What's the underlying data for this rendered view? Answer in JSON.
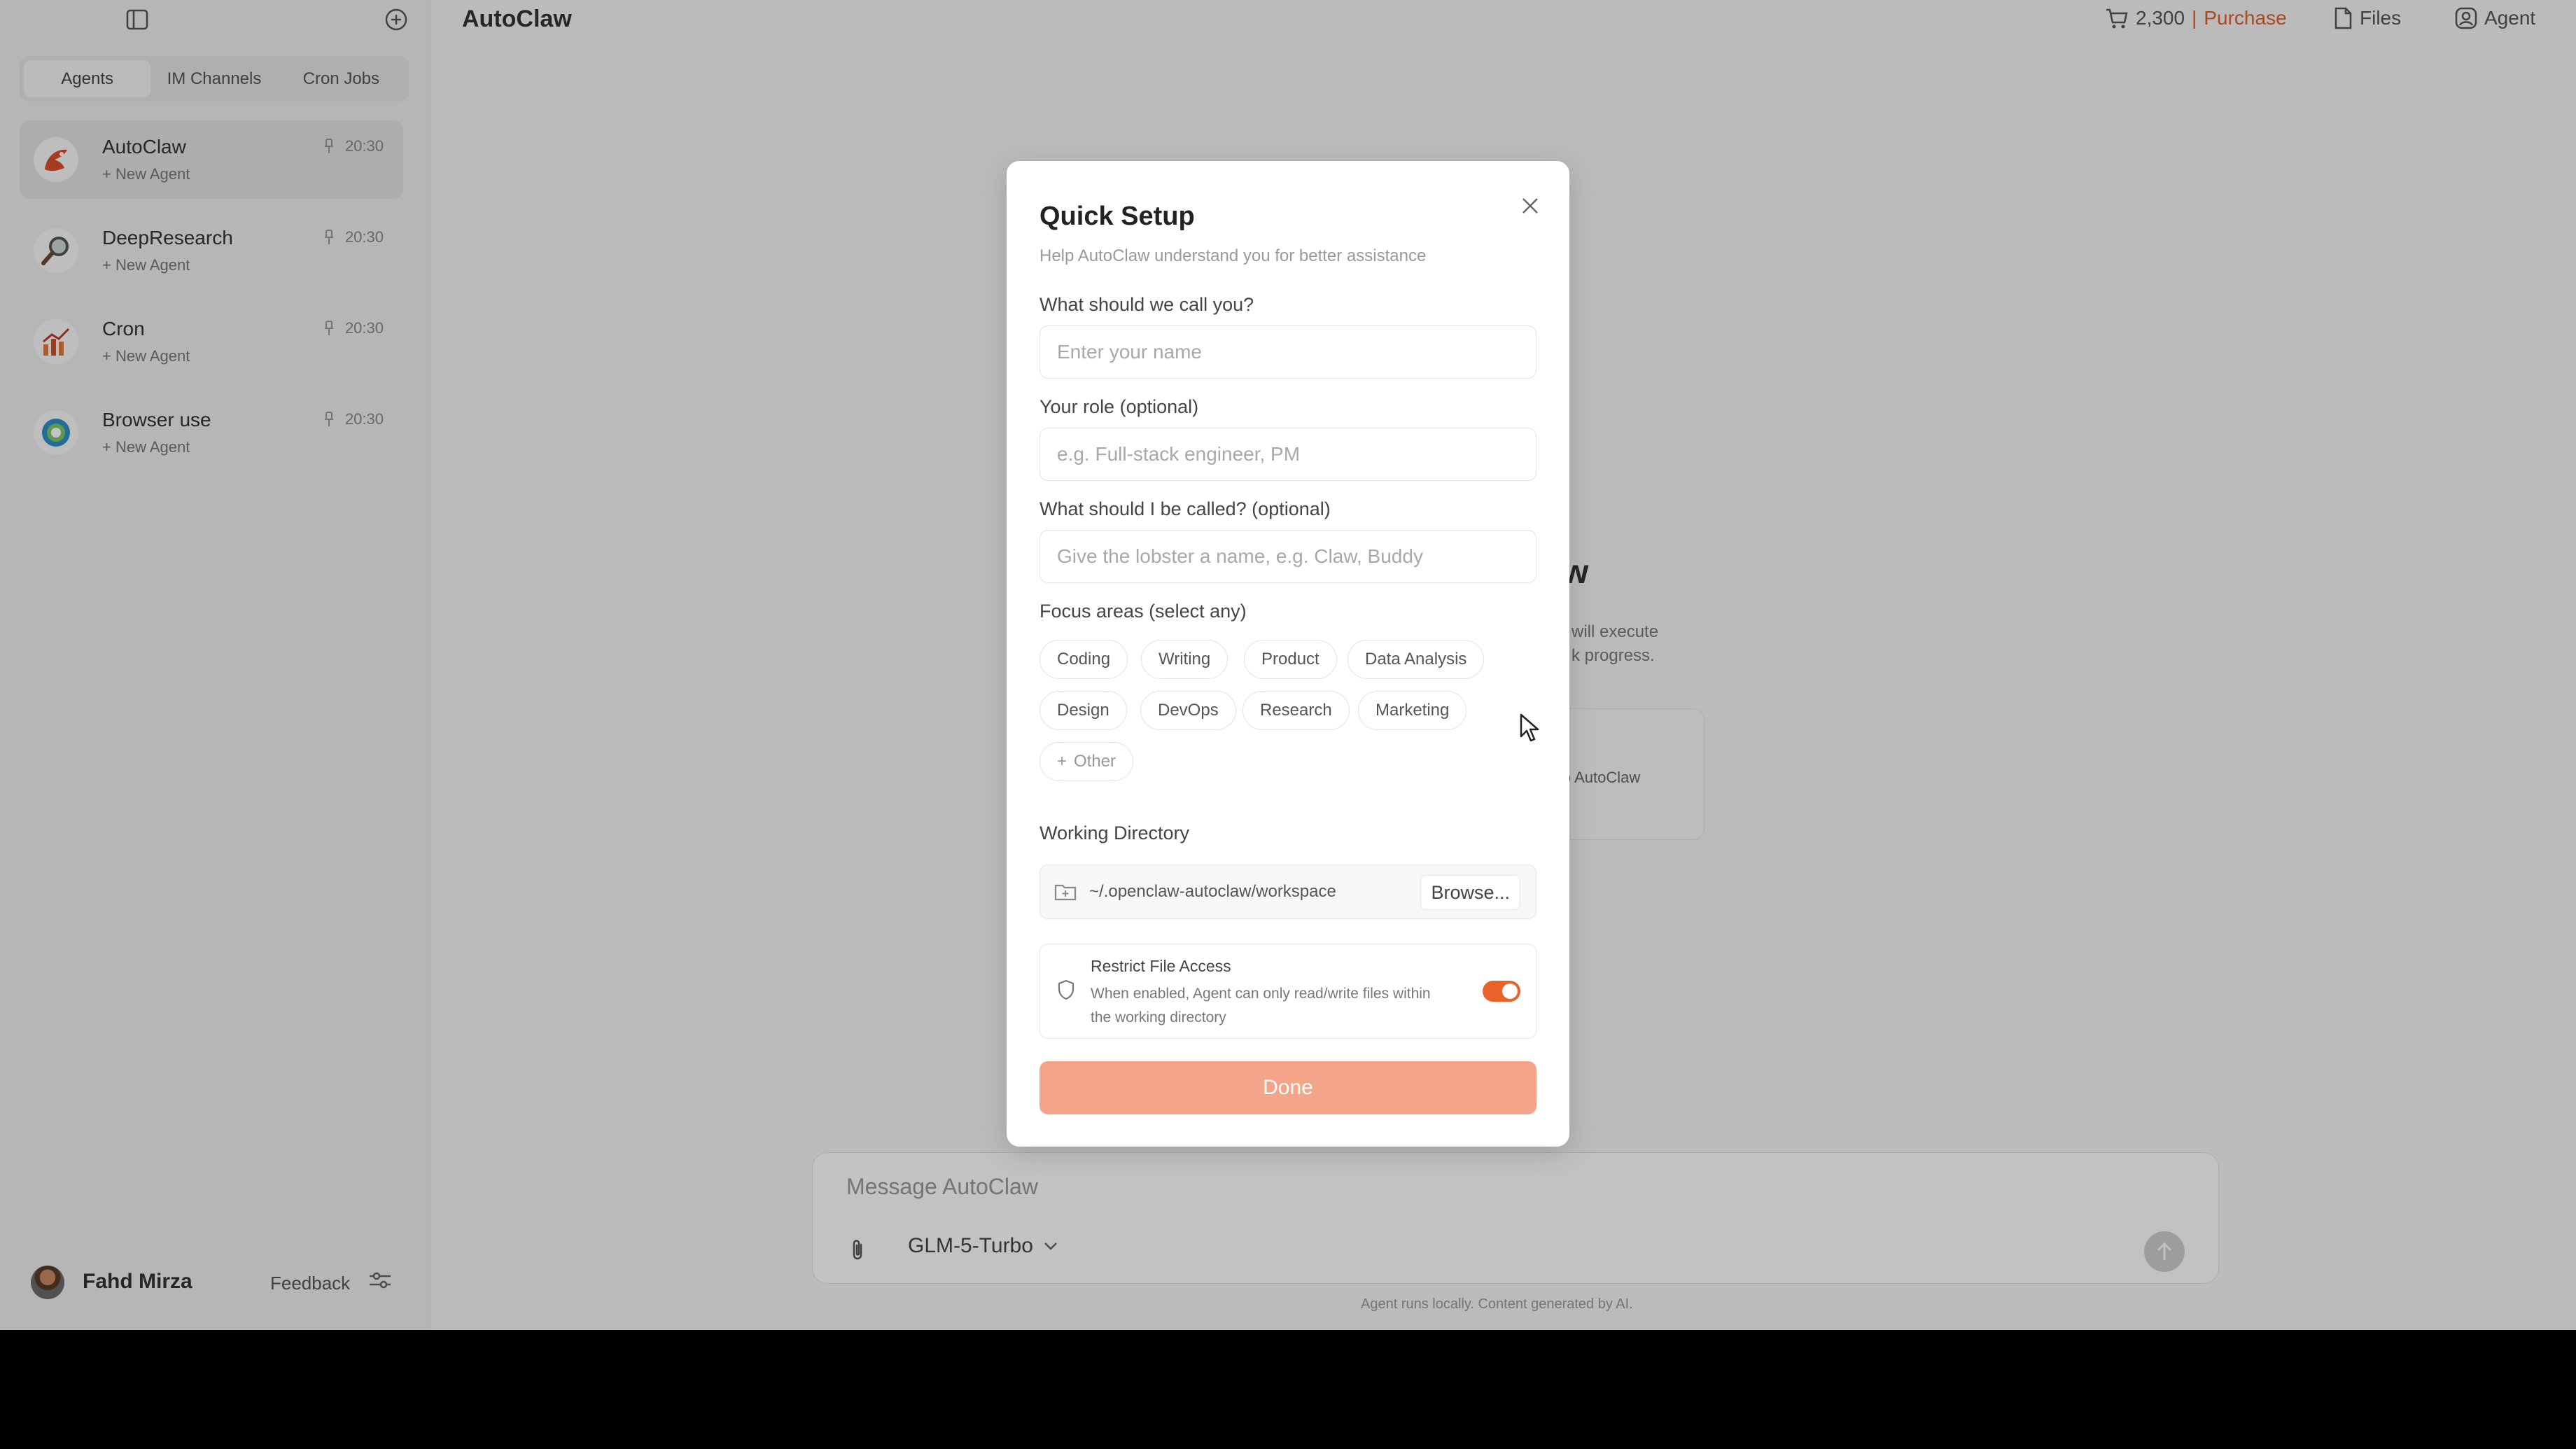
{
  "header": {
    "title": "AutoClaw",
    "credits": "2,300",
    "separator": "|",
    "purchase_label": "Purchase",
    "files_label": "Files",
    "agent_label": "Agent"
  },
  "sidebar": {
    "tabs": [
      {
        "label": "Agents",
        "active": true
      },
      {
        "label": "IM Channels",
        "active": false
      },
      {
        "label": "Cron Jobs",
        "active": false
      }
    ],
    "agents": [
      {
        "name": "AutoClaw",
        "sub": "+ New Agent",
        "time": "20:30",
        "icon": "claw-icon",
        "active": true
      },
      {
        "name": "DeepResearch",
        "sub": "+ New Agent",
        "time": "20:30",
        "icon": "magnifier-icon",
        "active": false
      },
      {
        "name": "Cron",
        "sub": "+ New Agent",
        "time": "20:30",
        "icon": "chart-icon",
        "active": false
      },
      {
        "name": "Browser use",
        "sub": "+ New Agent",
        "time": "20:30",
        "icon": "browser-icon",
        "active": false
      }
    ],
    "user_name": "Fahd Mirza",
    "feedback_label": "Feedback"
  },
  "background": {
    "heading_fragment": "w",
    "text_line1": "will execute",
    "text_line2": "k progress.",
    "card_text": "o AutoClaw"
  },
  "composer": {
    "placeholder": "Message AutoClaw",
    "model": "GLM-5-Turbo",
    "disclaimer": "Agent runs locally. Content generated by AI."
  },
  "modal": {
    "title": "Quick Setup",
    "subtitle": "Help AutoClaw understand you for better assistance",
    "name_label": "What should we call you?",
    "name_placeholder": "Enter your name",
    "role_label": "Your role (optional)",
    "role_placeholder": "e.g. Full-stack engineer, PM",
    "nickname_label": "What should I be called? (optional)",
    "nickname_placeholder": "Give the lobster a name, e.g. Claw, Buddy",
    "focus_label": "Focus areas (select any)",
    "focus_areas": [
      "Coding",
      "Writing",
      "Product",
      "Data Analysis",
      "Design",
      "DevOps",
      "Research",
      "Marketing"
    ],
    "other_label": "Other",
    "wd_label": "Working Directory",
    "wd_path": "~/.openclaw-autoclaw/workspace",
    "browse_label": "Browse...",
    "restrict_title": "Restrict File Access",
    "restrict_desc": "When enabled, Agent can only read/write files within the working directory",
    "restrict_enabled": true,
    "done_label": "Done"
  },
  "colors": {
    "accent": "#e8622a",
    "done_button": "#f4a589",
    "purchase": "#e25e2e"
  }
}
